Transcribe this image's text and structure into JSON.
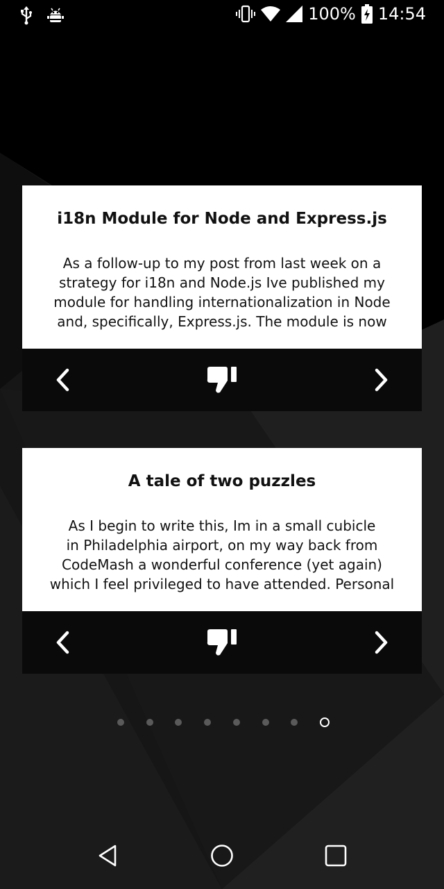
{
  "status_bar": {
    "battery_text": "100%",
    "time": "14:54",
    "icons": [
      "usb-icon",
      "android-debug-icon",
      "vibrate-icon",
      "wifi-icon",
      "cell-signal-icon",
      "battery-charging-icon"
    ]
  },
  "cards": [
    {
      "title": "i18n Module for Node and Express.js",
      "text": "As a follow-up to my post from last week on a\nstrategy for i18n and Node.js Ive published my\nmodule for handling internationalization in Node\nand, specifically, Express.js. The module is now",
      "prev_icon": "chevron-left-icon",
      "dislike_icon": "thumbs-down-icon",
      "next_icon": "chevron-right-icon"
    },
    {
      "title": "A tale of two puzzles",
      "text": "As I begin to write this, Im in a small cubicle\nin Philadelphia airport, on my way back from\nCodeMash  a wonderful conference (yet again)\nwhich I feel privileged to have attended. Personal",
      "prev_icon": "chevron-left-icon",
      "dislike_icon": "thumbs-down-icon",
      "next_icon": "chevron-right-icon"
    }
  ],
  "pager": {
    "total_pages": 8,
    "current_page": 8
  },
  "navbar": {
    "icons": [
      "back-icon",
      "home-icon",
      "recents-icon"
    ]
  },
  "colors": {
    "background": "#000000",
    "card_body": "#ffffff",
    "card_bar": "#0a0a0a",
    "dot_inactive": "#5a5a5a",
    "dot_active": "#ffffff"
  }
}
